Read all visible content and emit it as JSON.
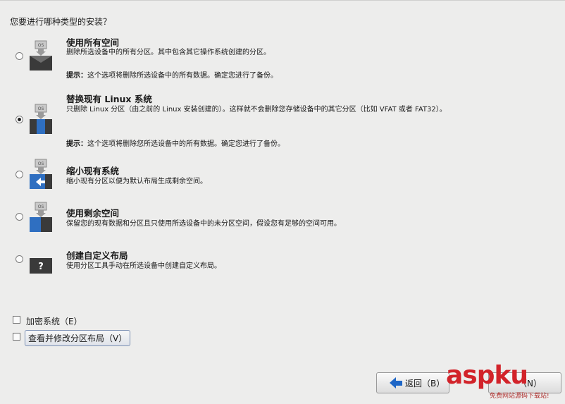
{
  "question": "您要进行哪种类型的安装？",
  "options": [
    {
      "title": "使用所有空间",
      "desc": "删除所选设备中的所有分区。其中包含其它操作系统创建的分区。",
      "warn_label": "提示：",
      "warn": "这个选项将删除所选设备中的所有数据。确定您进行了备份。",
      "selected": false,
      "icon": "disk-os-full-icon"
    },
    {
      "title": "替换现有 Linux 系统",
      "desc": "只删除 Linux 分区（由之前的 Linux 安装创建的）。这样就不会删除您存储设备中的其它分区（比如 VFAT 或者 FAT32）。",
      "warn_label": "提示：",
      "warn": "这个选项将删除您所选设备中的所有数据。确定您进行了备份。",
      "selected": true,
      "icon": "disk-os-replace-icon"
    },
    {
      "title": "缩小现有系统",
      "desc": "缩小现有分区以便为默认布局生成剩余空间。",
      "selected": false,
      "icon": "disk-shrink-icon"
    },
    {
      "title": "使用剩余空间",
      "desc": "保留您的现有数据和分区且只使用所选设备中的未分区空间，假设您有足够的空间可用。",
      "selected": false,
      "icon": "disk-free-space-icon"
    },
    {
      "title": "创建自定义布局",
      "desc": "使用分区工具手动在所选设备中创建自定义布局。",
      "selected": false,
      "icon": "disk-custom-icon"
    }
  ],
  "checkboxes": {
    "encrypt": {
      "label": "加密系统（E）",
      "checked": false
    },
    "review": {
      "label": "查看并修改分区布局（V）",
      "checked": false
    }
  },
  "buttons": {
    "back": "返回（B）",
    "next": "（N）"
  },
  "watermark": {
    "text": "aspku",
    "sub": "免费网站源码下载站!"
  },
  "colors": {
    "accent": "#1e66c6",
    "icon_dark": "#3a3a3a",
    "icon_blue": "#2f6fc1"
  }
}
